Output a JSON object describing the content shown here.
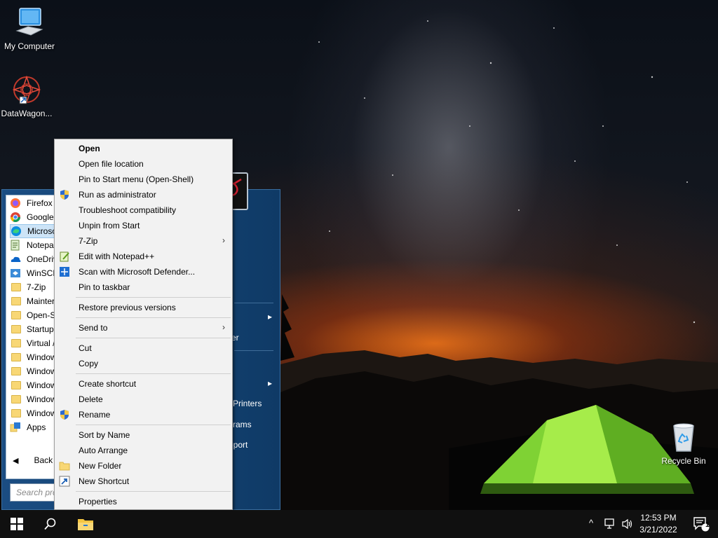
{
  "desktop": {
    "icons": [
      {
        "label": "My Computer",
        "icon": "computer-icon"
      },
      {
        "label": "DataWagon...",
        "icon": "datawagon-shortcut-icon"
      },
      {
        "label": "Recycle Bin",
        "icon": "recycle-bin-icon"
      }
    ]
  },
  "start_menu": {
    "programs": [
      {
        "label": "Firefox",
        "icon": "firefox-icon"
      },
      {
        "label": "Google",
        "icon": "chrome-icon"
      },
      {
        "label": "Microso",
        "icon": "edge-icon"
      },
      {
        "label": "Notepa",
        "icon": "notepad-icon"
      },
      {
        "label": "OneDriv",
        "icon": "onedrive-icon"
      },
      {
        "label": "WinSCP",
        "icon": "winscp-icon"
      },
      {
        "label": "7-Zip",
        "icon": "folder-icon"
      },
      {
        "label": "Mainter",
        "icon": "folder-icon"
      },
      {
        "label": "Open-S",
        "icon": "folder-icon"
      },
      {
        "label": "Startup",
        "icon": "folder-icon"
      },
      {
        "label": "Virtual /",
        "icon": "folder-icon"
      },
      {
        "label": "Window",
        "icon": "folder-icon"
      },
      {
        "label": "Window",
        "icon": "folder-icon"
      },
      {
        "label": "Window",
        "icon": "folder-icon"
      },
      {
        "label": "Window",
        "icon": "folder-icon"
      },
      {
        "label": "Window",
        "icon": "folder-icon"
      },
      {
        "label": "Apps",
        "icon": "apps-icon"
      }
    ],
    "back_label": "Back",
    "search_placeholder": "Search pro",
    "right_items": [
      {
        "label": "er"
      },
      {
        "label": "l"
      },
      {
        "label": "Printers"
      },
      {
        "label": "rams"
      },
      {
        "label": "pport"
      }
    ]
  },
  "context_menu": {
    "items": [
      {
        "label": "Open",
        "bold": true
      },
      {
        "label": "Open file location"
      },
      {
        "label": "Pin to Start menu (Open-Shell)"
      },
      {
        "label": "Run as administrator",
        "icon": "uac-shield-icon"
      },
      {
        "label": "Troubleshoot compatibility"
      },
      {
        "label": "Unpin from Start"
      },
      {
        "label": "7-Zip",
        "submenu": true
      },
      {
        "label": "Edit with Notepad++",
        "icon": "notepadpp-icon"
      },
      {
        "label": "Scan with Microsoft Defender...",
        "icon": "defender-icon"
      },
      {
        "label": "Pin to taskbar"
      },
      {
        "label": "Restore previous versions"
      },
      {
        "label": "Send to",
        "submenu": true
      },
      {
        "label": "Cut"
      },
      {
        "label": "Copy"
      },
      {
        "label": "Create shortcut"
      },
      {
        "label": "Delete"
      },
      {
        "label": "Rename",
        "icon": "uac-shield-icon"
      },
      {
        "label": "Sort by Name"
      },
      {
        "label": "Auto Arrange"
      },
      {
        "label": "New Folder",
        "icon": "folder-icon"
      },
      {
        "label": "New Shortcut",
        "icon": "shortcut-icon"
      },
      {
        "label": "Properties"
      }
    ]
  },
  "taskbar": {
    "time": "12:53 PM",
    "date": "3/21/2022",
    "notification_count": "1"
  },
  "colors": {
    "start_menu_blue": "#144372",
    "taskbar": "#101010",
    "menu_bg": "#f2f2f2",
    "selection": "#cde4f7"
  }
}
